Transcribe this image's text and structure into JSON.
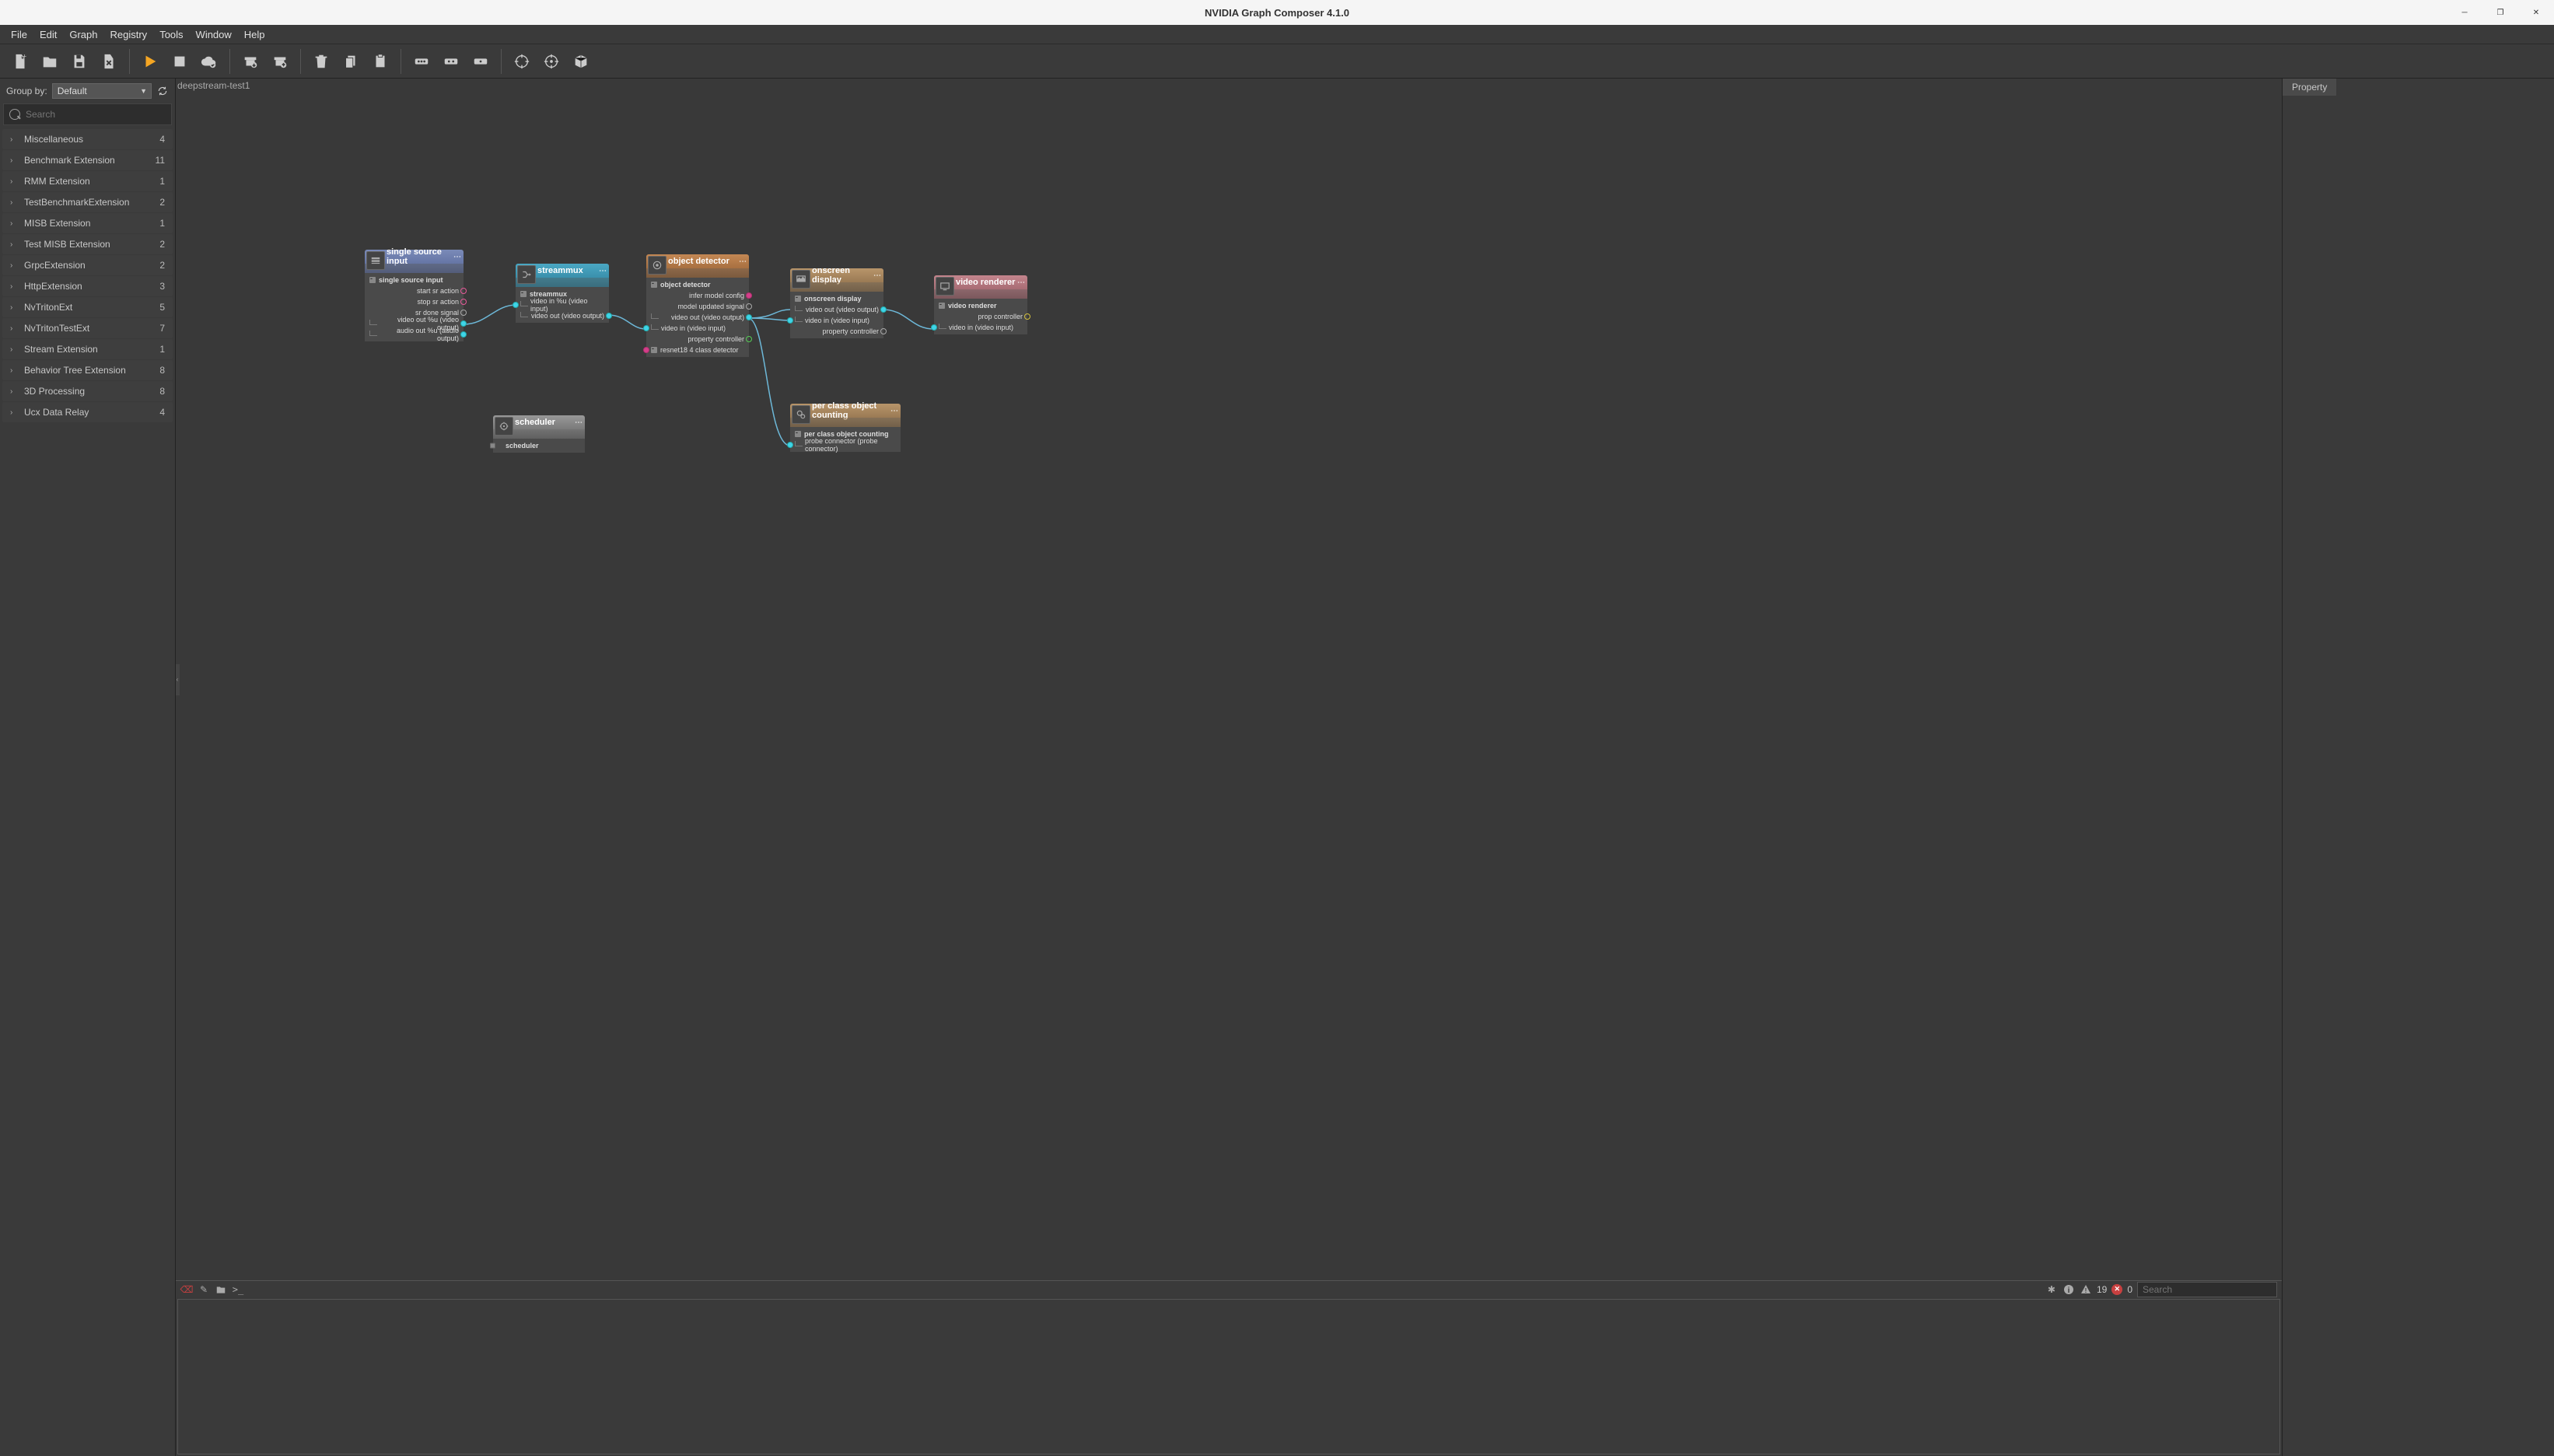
{
  "window": {
    "title": "NVIDIA Graph Composer 4.1.0"
  },
  "menubar": [
    "File",
    "Edit",
    "Graph",
    "Registry",
    "Tools",
    "Window",
    "Help"
  ],
  "sidebar": {
    "group_by_label": "Group by:",
    "group_by_value": "Default",
    "search_placeholder": "Search",
    "extensions": [
      {
        "name": "Miscellaneous",
        "count": 4
      },
      {
        "name": "Benchmark Extension",
        "count": 11
      },
      {
        "name": "RMM Extension",
        "count": 1
      },
      {
        "name": "TestBenchmarkExtension",
        "count": 2
      },
      {
        "name": "MISB Extension",
        "count": 1
      },
      {
        "name": "Test MISB Extension",
        "count": 2
      },
      {
        "name": "GrpcExtension",
        "count": 2
      },
      {
        "name": "HttpExtension",
        "count": 3
      },
      {
        "name": "NvTritonExt",
        "count": 5
      },
      {
        "name": "NvTritonTestExt",
        "count": 7
      },
      {
        "name": "Stream Extension",
        "count": 1
      },
      {
        "name": "Behavior Tree Extension",
        "count": 8
      },
      {
        "name": "3D Processing",
        "count": 8
      },
      {
        "name": "Ucx Data Relay",
        "count": 4
      }
    ]
  },
  "canvas": {
    "tab": "deepstream-test1",
    "nodes": {
      "single_source": {
        "title": "single source input",
        "section": "single source input",
        "rows": [
          {
            "label": "start sr action",
            "side": "right",
            "port": "pink hollow"
          },
          {
            "label": "stop sr action",
            "side": "right",
            "port": "pink hollow"
          },
          {
            "label": "sr done signal",
            "side": "right",
            "port": "gray hollow"
          },
          {
            "label": "video out %u (video output)",
            "side": "right",
            "port": "cyan"
          },
          {
            "label": "audio out %u (audio output)",
            "side": "right",
            "port": "cyan"
          }
        ]
      },
      "streammux": {
        "title": "streammux",
        "section": "streammux",
        "rows": [
          {
            "label": "video in %u (video input)",
            "side": "left",
            "port": "cyan"
          },
          {
            "label": "video out (video output)",
            "side": "right",
            "port": "cyan"
          }
        ]
      },
      "object_detector": {
        "title": "object detector",
        "section": "object detector",
        "rows": [
          {
            "label": "infer model config",
            "side": "right",
            "port": "magenta"
          },
          {
            "label": "model updated signal",
            "side": "right",
            "port": "gray hollow"
          },
          {
            "label": "video out (video output)",
            "side": "right",
            "port": "cyan"
          },
          {
            "label": "video in (video input)",
            "side": "left",
            "port": "cyan"
          },
          {
            "label": "property controller",
            "side": "right",
            "port": "magenta hollow"
          },
          {
            "label": "resnet18 4 class detector",
            "side": "left",
            "port": "magenta",
            "sect": true
          }
        ]
      },
      "onscreen_display": {
        "title": "onscreen display",
        "section": "onscreen display",
        "rows": [
          {
            "label": "video out (video output)",
            "side": "right",
            "port": "cyan"
          },
          {
            "label": "video in (video input)",
            "side": "left",
            "port": "cyan"
          },
          {
            "label": "property controller",
            "side": "right",
            "port": "gray hollow"
          }
        ]
      },
      "video_renderer": {
        "title": "video renderer",
        "section": "video renderer",
        "rows": [
          {
            "label": "prop controller",
            "side": "right",
            "port": "yellow hollow"
          },
          {
            "label": "video in (video input)",
            "side": "left",
            "port": "cyan"
          }
        ]
      },
      "scheduler": {
        "title": "scheduler",
        "section": "scheduler"
      },
      "per_class": {
        "title": "per class object counting",
        "section": "per class object counting",
        "rows": [
          {
            "label": "probe connector (probe connector)",
            "side": "left",
            "port": "cyan"
          }
        ]
      }
    }
  },
  "statusbar": {
    "info_count": "19",
    "error_count": "0",
    "search_placeholder": "Search"
  },
  "right_panel": {
    "tab": "Property"
  }
}
